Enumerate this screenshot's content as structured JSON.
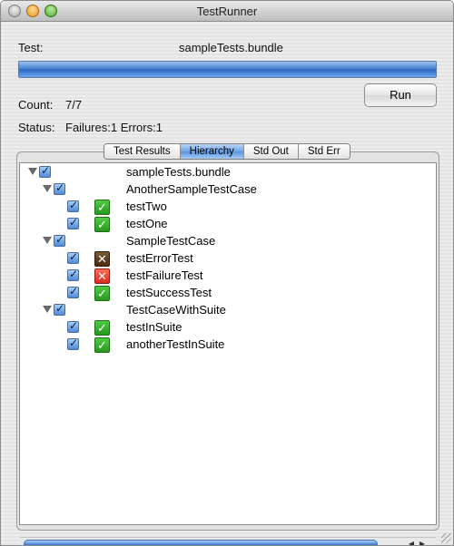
{
  "window": {
    "title": "TestRunner"
  },
  "header": {
    "test_label": "Test:",
    "test_value": "sampleTests.bundle",
    "progress": 1.0,
    "count_label": "Count:",
    "count_value": "7/7",
    "status_label": "Status:",
    "status_value": "Failures:1 Errors:1",
    "run_label": "Run"
  },
  "tabs": [
    "Test Results",
    "Hierarchy",
    "Std Out",
    "Std Err"
  ],
  "active_tab": "Hierarchy",
  "tree": [
    {
      "label": "sampleTests.bundle",
      "level": 0,
      "expanded": true,
      "checked": true,
      "status": null
    },
    {
      "label": "AnotherSampleTestCase",
      "level": 1,
      "expanded": true,
      "checked": true,
      "status": null
    },
    {
      "label": "testTwo",
      "level": 2,
      "checked": true,
      "status": "pass"
    },
    {
      "label": "testOne",
      "level": 2,
      "checked": true,
      "status": "pass"
    },
    {
      "label": "SampleTestCase",
      "level": 1,
      "expanded": true,
      "checked": true,
      "status": null
    },
    {
      "label": "testErrorTest",
      "level": 2,
      "checked": true,
      "status": "error"
    },
    {
      "label": "testFailureTest",
      "level": 2,
      "checked": true,
      "status": "fail"
    },
    {
      "label": "testSuccessTest",
      "level": 2,
      "checked": true,
      "status": "pass"
    },
    {
      "label": "TestCaseWithSuite",
      "level": 1,
      "expanded": true,
      "checked": true,
      "status": null
    },
    {
      "label": "testInSuite",
      "level": 2,
      "checked": true,
      "status": "pass"
    },
    {
      "label": "anotherTestInSuite",
      "level": 2,
      "checked": true,
      "status": "pass"
    }
  ],
  "icons": {
    "pass": "checkmark-icon",
    "error": "cross-icon",
    "fail": "cross-icon"
  },
  "colors": {
    "accent": "#4f86d7",
    "pass": "#2a9621",
    "error": "#4a2c14",
    "fail": "#d92a1e"
  }
}
